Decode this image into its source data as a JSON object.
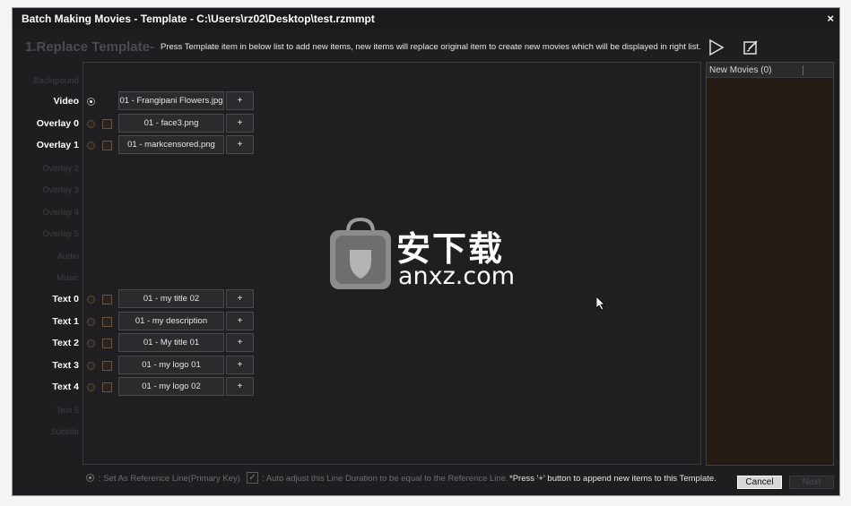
{
  "window": {
    "title": "Batch Making Movies - Template - C:\\Users\\rz02\\Desktop\\test.rzmmpt",
    "close_label": "×"
  },
  "header": {
    "step_title": "1.Replace Template-",
    "description": "Press Template item in below list to add new items, new items will replace original item to create new movies which will be displayed in right list."
  },
  "toolbar": {
    "play_icon": "play-icon",
    "edit_icon": "edit-icon"
  },
  "rows": [
    {
      "label": "Background",
      "active": false
    },
    {
      "label": "Video",
      "active": true,
      "selected": true,
      "item": "01 - Frangipani Flowers.jpg",
      "plus": "+"
    },
    {
      "label": "Overlay 0",
      "active": true,
      "item": "01 - face3.png",
      "plus": "+"
    },
    {
      "label": "Overlay 1",
      "active": true,
      "item": "01 - markcensored.png",
      "plus": "+"
    },
    {
      "label": "Overlay 2",
      "active": false
    },
    {
      "label": "Overlay 3",
      "active": false
    },
    {
      "label": "Overlay 4",
      "active": false
    },
    {
      "label": "Overlay 5",
      "active": false
    },
    {
      "label": "Audio",
      "active": false
    },
    {
      "label": "Music",
      "active": false
    },
    {
      "label": "Text 0",
      "active": true,
      "item": "01 - my title 02",
      "plus": "+"
    },
    {
      "label": "Text 1",
      "active": true,
      "item": "01 - my description",
      "plus": "+"
    },
    {
      "label": "Text 2",
      "active": true,
      "item": "01 - My title 01",
      "plus": "+"
    },
    {
      "label": "Text 3",
      "active": true,
      "item": "01 - my logo 01",
      "plus": "+"
    },
    {
      "label": "Text 4",
      "active": true,
      "item": "01 - my logo 02",
      "plus": "+"
    },
    {
      "label": "Text 5",
      "active": false
    },
    {
      "label": "Subtitle",
      "active": false
    }
  ],
  "right_list": {
    "header": "New Movies (0)"
  },
  "footer": {
    "reference_line": ": Set As Reference Line(Primary Key)",
    "auto_adjust": ": Auto adjust this Line Duration to be equal to the Reference Line.",
    "hint": "*Press '+' button to append new items to this Template.",
    "check_mark": "✓"
  },
  "buttons": {
    "cancel": "Cancel",
    "next": "Next"
  },
  "watermark": {
    "cn": "安下载",
    "en": "anxz.com"
  },
  "colors": {
    "window_bg": "#1e1e21",
    "right_panel_bg": "#251d15",
    "active_label": "#ffffff",
    "inactive_label": "#3e3e42"
  }
}
